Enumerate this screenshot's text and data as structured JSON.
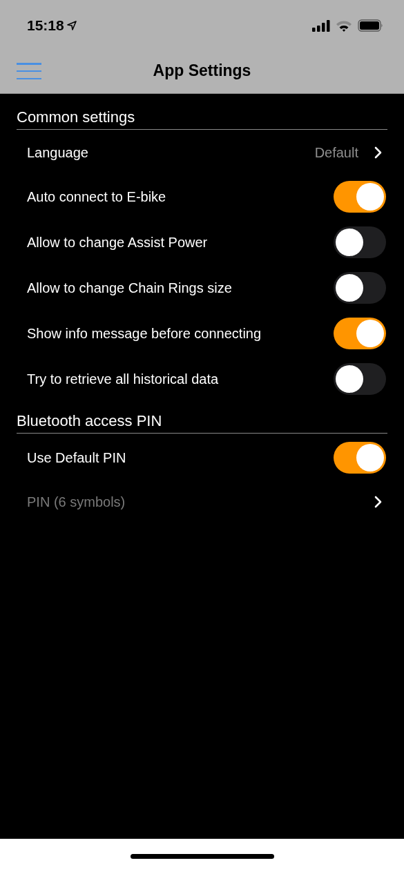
{
  "status_bar": {
    "time": "15:18"
  },
  "nav_bar": {
    "title": "App Settings"
  },
  "sections": [
    {
      "title": "Common settings",
      "rows": [
        {
          "kind": "link",
          "label": "Language",
          "value": "Default",
          "disabled": false
        },
        {
          "kind": "toggle",
          "label": "Auto connect to E-bike",
          "on": true
        },
        {
          "kind": "toggle",
          "label": "Allow to change Assist Power",
          "on": false
        },
        {
          "kind": "toggle",
          "label": "Allow to change Chain Rings size",
          "on": false
        },
        {
          "kind": "toggle",
          "label": "Show info message before connecting",
          "on": true
        },
        {
          "kind": "toggle",
          "label": "Try to retrieve all historical data",
          "on": false
        }
      ]
    },
    {
      "title": "Bluetooth access PIN",
      "rows": [
        {
          "kind": "toggle",
          "label": "Use Default PIN",
          "on": true
        },
        {
          "kind": "link",
          "label": "PIN (6 symbols)",
          "disabled": true
        }
      ]
    }
  ]
}
